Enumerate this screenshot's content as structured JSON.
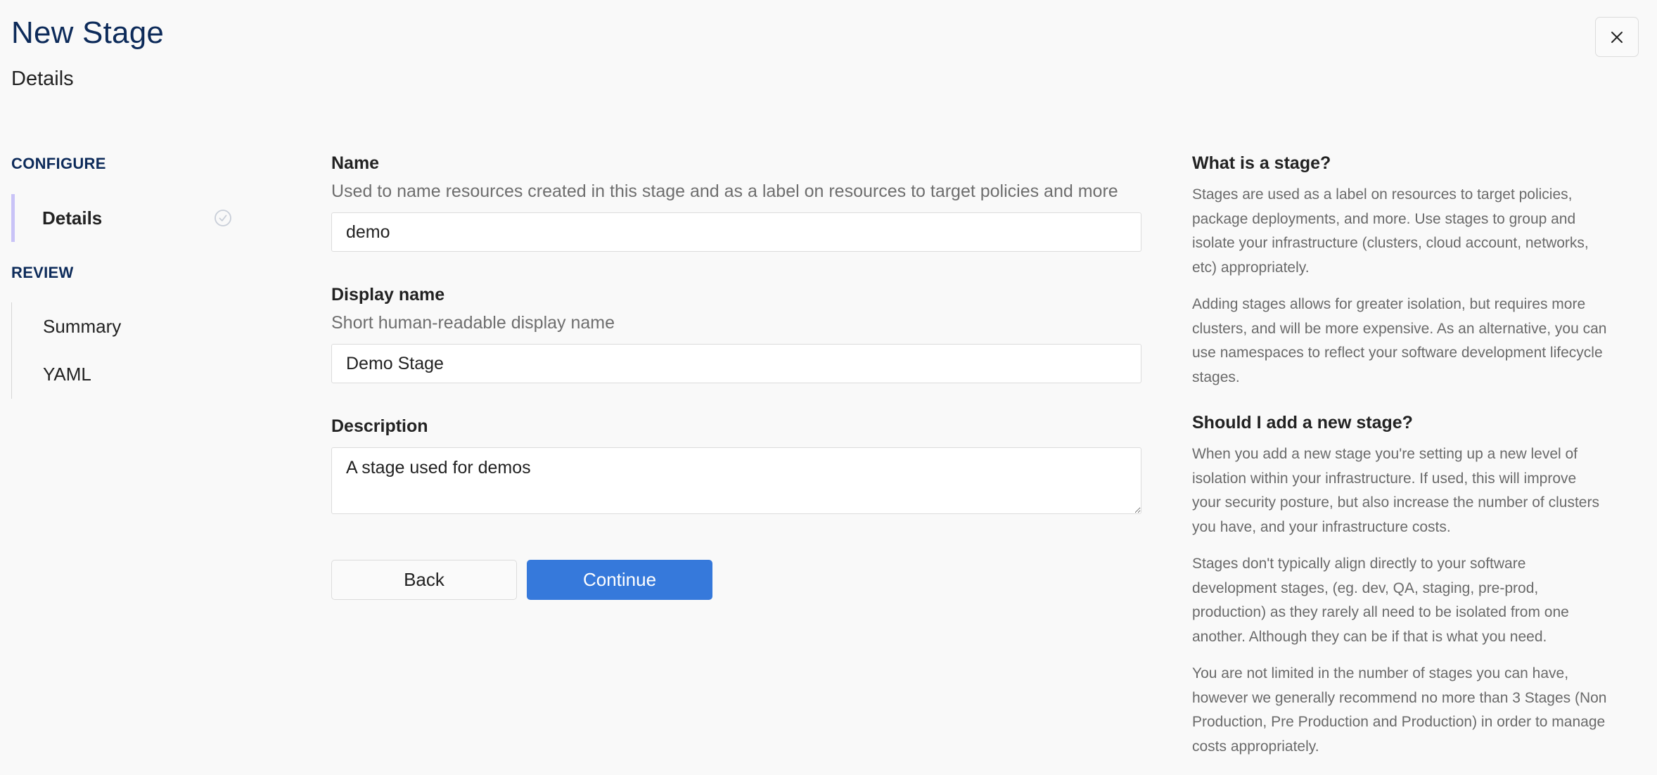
{
  "header": {
    "title": "New Stage",
    "subtitle": "Details",
    "close_label": "Close"
  },
  "sidebar": {
    "sections": [
      {
        "label": "CONFIGURE",
        "items": [
          {
            "label": "Details",
            "active": true,
            "completed": true
          }
        ]
      },
      {
        "label": "REVIEW",
        "items": [
          {
            "label": "Summary",
            "active": false,
            "completed": false
          },
          {
            "label": "YAML",
            "active": false,
            "completed": false
          }
        ]
      }
    ]
  },
  "form": {
    "name": {
      "label": "Name",
      "help": "Used to name resources created in this stage and as a label on resources to target policies and more",
      "value": "demo"
    },
    "display_name": {
      "label": "Display name",
      "help": "Short human-readable display name",
      "value": "Demo Stage"
    },
    "description": {
      "label": "Description",
      "value": "A stage used for demos"
    },
    "buttons": {
      "back": "Back",
      "continue": "Continue"
    }
  },
  "help": {
    "sections": [
      {
        "heading": "What is a stage?",
        "paragraphs": [
          "Stages are used as a label on resources to target policies, package deployments, and more. Use stages to group and isolate your infrastructure (clusters, cloud account, networks, etc) appropriately.",
          "Adding stages allows for greater isolation, but requires more clusters, and will be more expensive. As an alternative, you can use namespaces to reflect your software development lifecycle stages."
        ]
      },
      {
        "heading": "Should I add a new stage?",
        "paragraphs": [
          "When you add a new stage you're setting up a new level of isolation within your infrastructure. If used, this will improve your security posture, but also increase the number of clusters you have, and your infrastructure costs.",
          "Stages don't typically align directly to your software development stages, (eg. dev, QA, staging, pre-prod, production) as they rarely all need to be isolated from one another. Although they can be if that is what you need.",
          "You are not limited in the number of stages you can have, however we generally recommend no more than 3 Stages (Non Production, Pre Production and Production) in order to manage costs appropriately."
        ]
      }
    ]
  },
  "colors": {
    "title": "#0d2b5a",
    "primary_button": "#3679db",
    "active_nav_indicator": "#c9c3f7",
    "background": "#f9f9f9",
    "help_text": "#6a6a6a"
  }
}
